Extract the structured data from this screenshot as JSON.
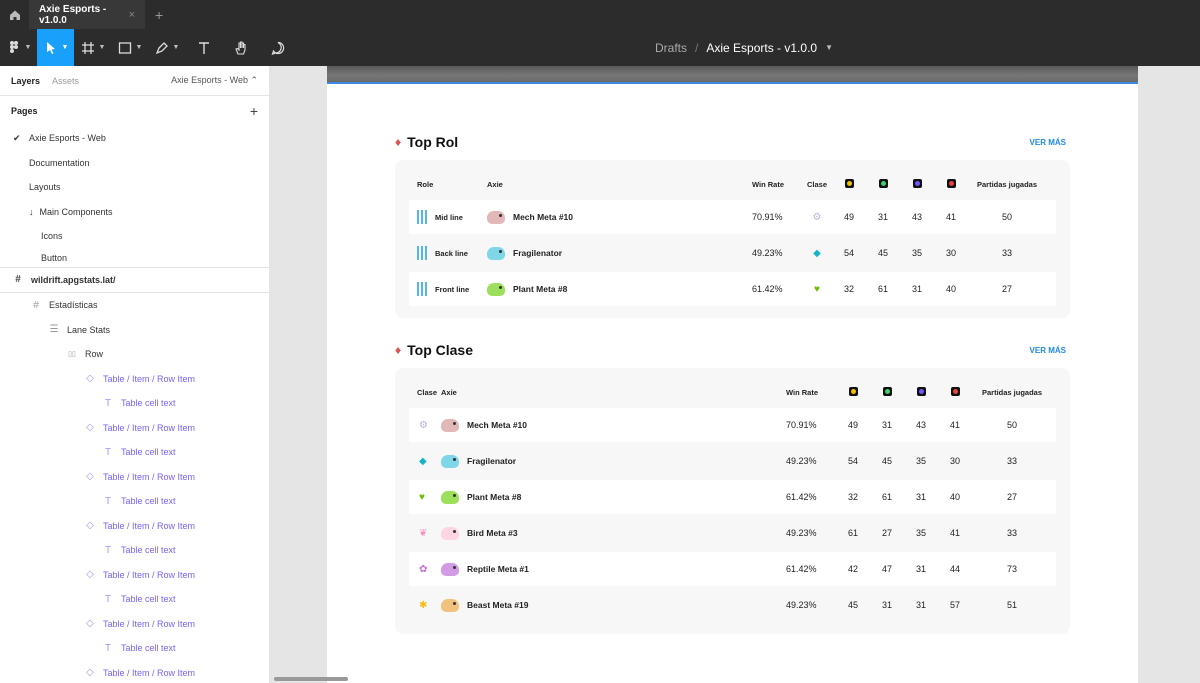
{
  "titlebar": {
    "tab_title": "Axie Esports - v1.0.0",
    "close": "×",
    "new_tab": "+"
  },
  "toolbar": {
    "breadcrumb_drafts": "Drafts",
    "breadcrumb_sep": "/",
    "file_name": "Axie Esports - v1.0.0"
  },
  "left_panel": {
    "tab_layers": "Layers",
    "tab_assets": "Assets",
    "page_selector": "Axie Esports - Web ⌃",
    "pages_heading": "Pages",
    "pages": [
      "Axie Esports - Web",
      "Documentation",
      "Layouts",
      "Main Components",
      "Icons",
      "Button"
    ],
    "layers": [
      {
        "label": "wildrift.apgstats.lat/",
        "icon": "#"
      },
      {
        "label": "Estadísticas",
        "icon": "#"
      },
      {
        "label": "Lane Stats",
        "icon": "☰"
      },
      {
        "label": "Row",
        "icon": "▯▯"
      },
      {
        "label": "Table / Item / Row Item",
        "icon": "◇"
      },
      {
        "label": "Table cell text",
        "icon": "T"
      },
      {
        "label": "Table / Item / Row Item",
        "icon": "◇"
      },
      {
        "label": "Table cell text",
        "icon": "T"
      },
      {
        "label": "Table / Item / Row Item",
        "icon": "◇"
      },
      {
        "label": "Table cell text",
        "icon": "T"
      },
      {
        "label": "Table / Item / Row Item",
        "icon": "◇"
      },
      {
        "label": "Table cell text",
        "icon": "T"
      },
      {
        "label": "Table / Item / Row Item",
        "icon": "◇"
      },
      {
        "label": "Table cell text",
        "icon": "T"
      },
      {
        "label": "Table / Item / Row Item",
        "icon": "◇"
      },
      {
        "label": "Table cell text",
        "icon": "T"
      },
      {
        "label": "Table / Item / Row Item",
        "icon": "◇"
      }
    ]
  },
  "top_rol": {
    "title": "Top Rol",
    "more": "VER MÁS",
    "headers": {
      "role": "Role",
      "axie": "Axie",
      "winrate": "Win Rate",
      "clase": "Clase",
      "played": "Partidas jugadas"
    },
    "rows": [
      {
        "role": "Mid line",
        "axie": "Mech Meta #10",
        "winrate": "70.91%",
        "class_color": "#b9b0d6",
        "class_glyph": "⚙",
        "s1": "49",
        "s2": "31",
        "s3": "43",
        "s4": "41",
        "played": "50",
        "pet_color": "#e2b7b7"
      },
      {
        "role": "Back line",
        "axie": "Fragilenator",
        "winrate": "49.23%",
        "class_color": "#13b6c9",
        "class_glyph": "◆",
        "s1": "54",
        "s2": "45",
        "s3": "35",
        "s4": "30",
        "played": "33",
        "pet_color": "#7ed6e8"
      },
      {
        "role": "Front line",
        "axie": "Plant Meta #8",
        "winrate": "61.42%",
        "class_color": "#6cc000",
        "class_glyph": "♥",
        "s1": "32",
        "s2": "61",
        "s3": "31",
        "s4": "40",
        "played": "27",
        "pet_color": "#9bdf5a"
      }
    ]
  },
  "top_clase": {
    "title": "Top Clase",
    "more": "VER MÁS",
    "headers": {
      "clase": "Clase",
      "axie": "Axie",
      "winrate": "Win Rate",
      "played": "Partidas jugadas"
    },
    "rows": [
      {
        "class_color": "#b9b0d6",
        "class_glyph": "⚙",
        "axie": "Mech Meta #10",
        "winrate": "70.91%",
        "s1": "49",
        "s2": "31",
        "s3": "43",
        "s4": "41",
        "played": "50",
        "pet_color": "#e2b7b7"
      },
      {
        "class_color": "#13b6c9",
        "class_glyph": "◆",
        "axie": "Fragilenator",
        "winrate": "49.23%",
        "s1": "54",
        "s2": "45",
        "s3": "35",
        "s4": "30",
        "played": "33",
        "pet_color": "#7ed6e8"
      },
      {
        "class_color": "#6cc000",
        "class_glyph": "♥",
        "axie": "Plant Meta #8",
        "winrate": "61.42%",
        "s1": "32",
        "s2": "61",
        "s3": "31",
        "s4": "40",
        "played": "27",
        "pet_color": "#9bdf5a"
      },
      {
        "class_color": "#ff8abc",
        "class_glyph": "❦",
        "axie": "Bird Meta #3",
        "winrate": "49.23%",
        "s1": "61",
        "s2": "27",
        "s3": "35",
        "s4": "41",
        "played": "33",
        "pet_color": "#ffd4e3"
      },
      {
        "class_color": "#c56bd8",
        "class_glyph": "✿",
        "axie": "Reptile Meta #1",
        "winrate": "61.42%",
        "s1": "42",
        "s2": "47",
        "s3": "31",
        "s4": "44",
        "played": "73",
        "pet_color": "#d39be6"
      },
      {
        "class_color": "#ffb812",
        "class_glyph": "✱",
        "axie": "Beast Meta #19",
        "winrate": "49.23%",
        "s1": "45",
        "s2": "31",
        "s3": "31",
        "s4": "57",
        "played": "51",
        "pet_color": "#f1c27d"
      }
    ]
  }
}
